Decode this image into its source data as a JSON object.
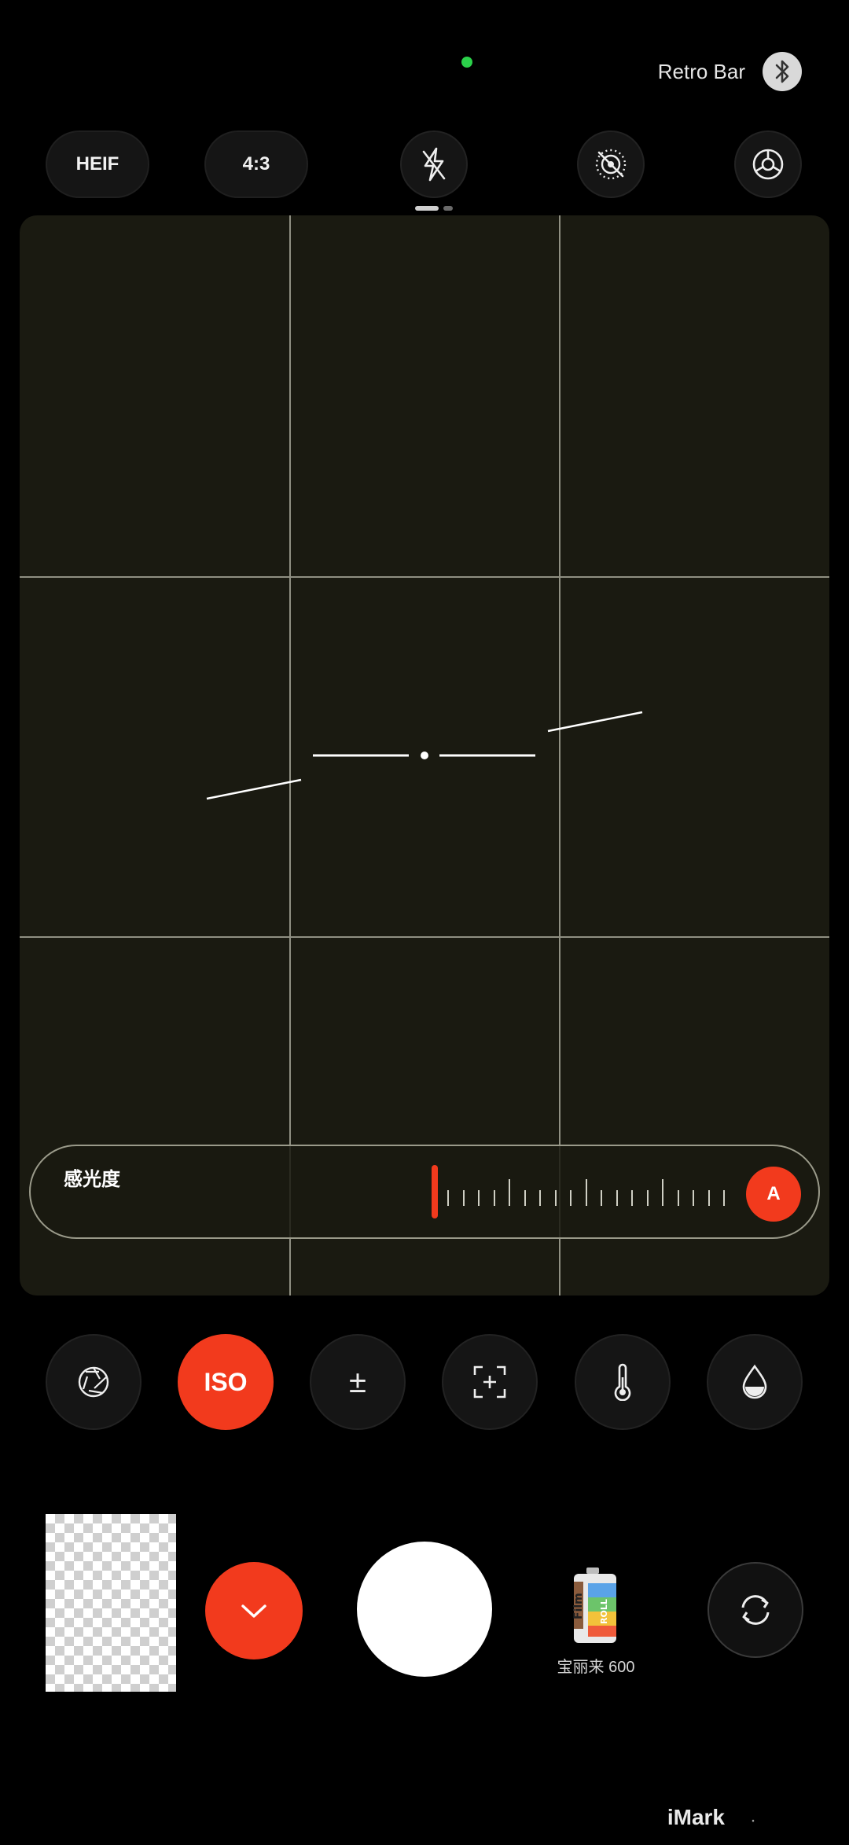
{
  "status": {
    "bluetooth_device": "Retro Bar"
  },
  "top_bar": {
    "format": "HEIF",
    "aspect_ratio": "4:3",
    "flash_icon": "flash-off-icon",
    "live_icon": "live-off-icon",
    "settings_icon": "gear-icon"
  },
  "viewfinder": {
    "grid": "3x3",
    "level_indicator": true
  },
  "iso_slider": {
    "label": "感光度",
    "auto_label": "A",
    "accent": "#f23a1d"
  },
  "modes": [
    {
      "name": "aperture",
      "icon": "aperture-icon"
    },
    {
      "name": "iso",
      "label": "ISO",
      "active": true
    },
    {
      "name": "exposure",
      "label": "±"
    },
    {
      "name": "focus",
      "icon": "focus-icon"
    },
    {
      "name": "white-balance",
      "icon": "thermometer-icon"
    },
    {
      "name": "tint",
      "icon": "drop-icon"
    }
  ],
  "bottom": {
    "film_name": "宝丽来 600",
    "film_icon_text": "Film",
    "film_icon_subtext": "ROLL"
  },
  "watermark": {
    "brand": "iMark",
    "separator": "·"
  }
}
